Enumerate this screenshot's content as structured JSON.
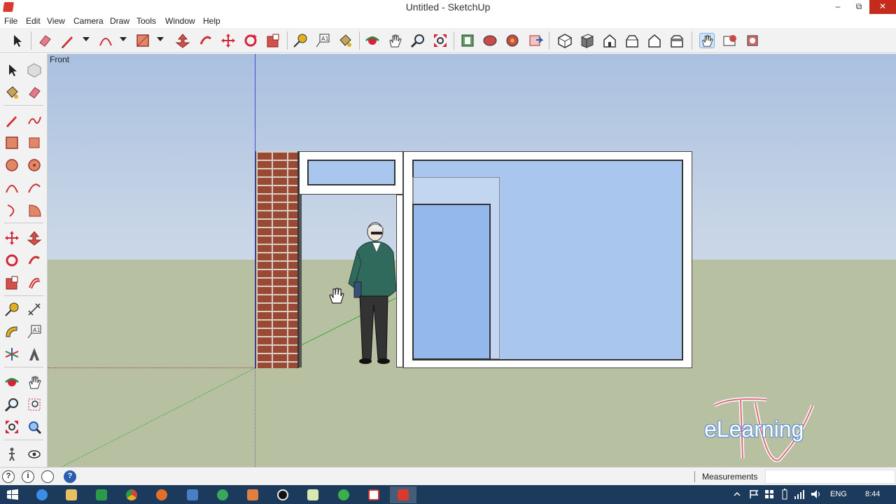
{
  "window": {
    "title": "Untitled - SketchUp",
    "minimize_glyph": "–",
    "restore_glyph": "⧉",
    "close_glyph": "✕"
  },
  "menu": [
    "File",
    "Edit",
    "View",
    "Camera",
    "Draw",
    "Tools",
    "Window",
    "Help"
  ],
  "viewport": {
    "view_label": "Front"
  },
  "statusbar": {
    "measurements_label": "Measurements",
    "measurements_value": "",
    "icons": [
      "?",
      "i",
      "user",
      "?"
    ]
  },
  "logo": {
    "text": "eLearning",
    "letters": "TV"
  },
  "taskbar": {
    "tray_language": "ENG",
    "tray_time": "8:44"
  },
  "colors": {
    "brand_red": "#d83a2e",
    "sky": "#a9c0df",
    "ground": "#b7c0a0",
    "glass": "#a9c6ef",
    "taskbar": "#1b3a5c"
  }
}
